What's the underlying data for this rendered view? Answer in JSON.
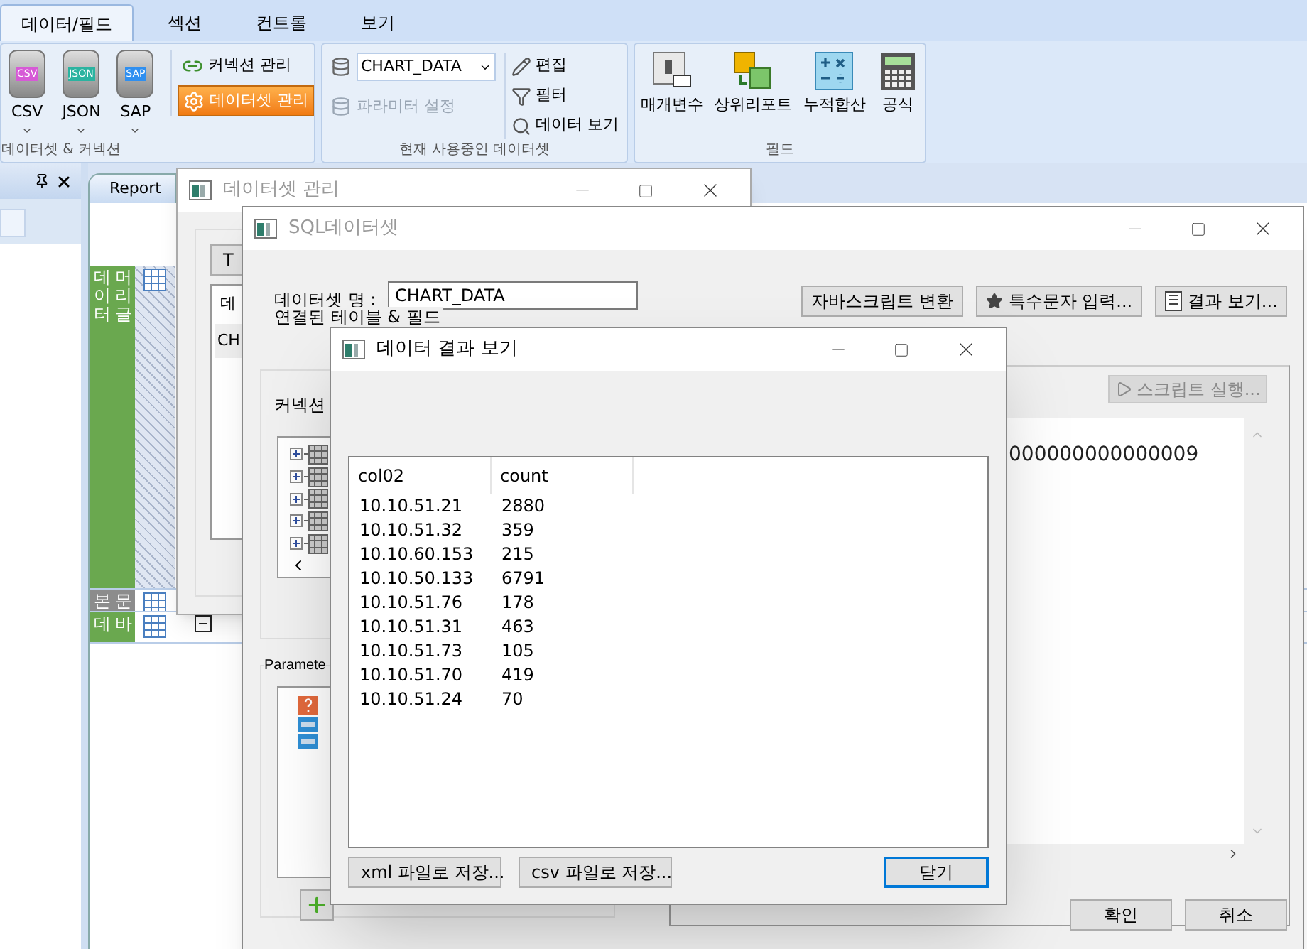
{
  "ribbon": {
    "tabs": [
      {
        "label": "데이터/필드",
        "selected": true
      },
      {
        "label": "섹션",
        "selected": false
      },
      {
        "label": "컨트롤",
        "selected": false
      },
      {
        "label": "보기",
        "selected": false
      }
    ],
    "dataset_group": {
      "label": "데이터셋 & 커넥션",
      "sources": [
        {
          "label": "CSV",
          "icon_text": "CSV",
          "color": "#d65ad6"
        },
        {
          "label": "JSON",
          "icon_text": "JSON",
          "color": "#2bb3a0"
        },
        {
          "label": "SAP",
          "icon_text": "SAP",
          "color": "#2f8ff0"
        }
      ],
      "buttons": [
        {
          "label": "커넥션 관리",
          "selected": false
        },
        {
          "label": "데이터셋 관리",
          "selected": true
        }
      ]
    },
    "current_group": {
      "label": "현재 사용중인 데이터셋",
      "dataset": "CHART_DATA",
      "param_button": {
        "label": "파라미터 설정",
        "disabled": true
      },
      "buttons": [
        {
          "label": "편집"
        },
        {
          "label": "필터"
        },
        {
          "label": "데이터 보기"
        }
      ]
    },
    "field_group": {
      "label": "필드",
      "buttons": [
        {
          "label": "매개변수"
        },
        {
          "label": "상위리포트"
        },
        {
          "label": "누적합산"
        },
        {
          "label": "공식"
        }
      ]
    }
  },
  "designer": {
    "tab": "Report",
    "bands": [
      {
        "columns": [
          "데이터",
          "머리글"
        ],
        "color": "#6aa84f"
      },
      {
        "columns": [
          "본",
          "문"
        ],
        "color": "#8c8c8c"
      },
      {
        "columns": [
          "데",
          "바"
        ],
        "color": "#6aa84f"
      }
    ]
  },
  "dataset_manager": {
    "title": "데이터셋 관리",
    "button": "T",
    "list_header": "데",
    "list_row": "CH"
  },
  "sql_dataset": {
    "title": "SQL데이터셋",
    "name_label": "데이터셋 명 :",
    "name_value": "CHART_DATA",
    "buttons": [
      {
        "label": "자바스크립트 변환"
      },
      {
        "label": "특수문자 입력..."
      },
      {
        "label": "결과 보기..."
      }
    ],
    "tables_group": "연결된 테이블 & 필드",
    "connection_label": "커넥션",
    "parameters_group": "Paramete",
    "run_button": {
      "label": "스크립트 실행...",
      "disabled": true
    },
    "script_text": "000000000000009",
    "ok": "확인",
    "cancel": "취소"
  },
  "result_view": {
    "title": "데이터 결과 보기",
    "columns": [
      "col02",
      "count"
    ],
    "rows": [
      [
        "10.10.51.21",
        "2880"
      ],
      [
        "10.10.51.32",
        "359"
      ],
      [
        "10.10.60.153",
        "215"
      ],
      [
        "10.10.50.133",
        "6791"
      ],
      [
        "10.10.51.76",
        "178"
      ],
      [
        "10.10.51.31",
        "463"
      ],
      [
        "10.10.51.73",
        "105"
      ],
      [
        "10.10.51.70",
        "419"
      ],
      [
        "10.10.51.24",
        "70"
      ]
    ],
    "buttons": [
      {
        "label": "xml 파일로 저장...",
        "focused": false
      },
      {
        "label": "csv 파일로 저장...",
        "focused": false
      },
      {
        "label": "닫기",
        "focused": true
      }
    ]
  }
}
